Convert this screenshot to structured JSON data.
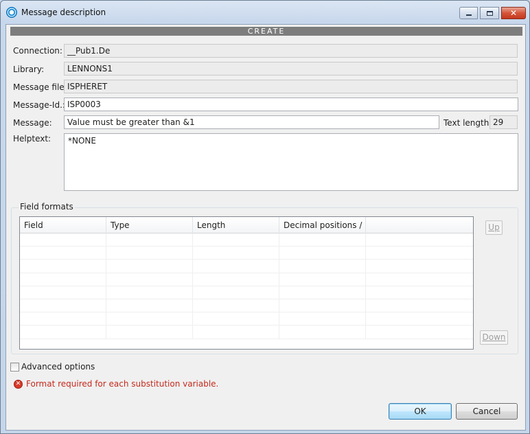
{
  "window": {
    "title": "Message description"
  },
  "banner": "CREATE",
  "form": {
    "connection_label": "Connection:",
    "connection_value": "__Pub1.De",
    "library_label": "Library:",
    "library_value": "LENNONS1",
    "message_file_label": "Message file:",
    "message_file_value": "ISPHERET",
    "message_id_label": "Message-Id.:",
    "message_id_value": "ISP0003",
    "message_label": "Message:",
    "message_value": "Value must be greater than &1",
    "text_length_label": "Text length:",
    "text_length_value": "29",
    "helptext_label": "Helptext:",
    "helptext_value": "*NONE"
  },
  "field_formats": {
    "group_label": "Field formats",
    "columns": [
      "Field",
      "Type",
      "Length",
      "Decimal positions / ...",
      ""
    ],
    "row_count": 8,
    "up_label": "Up",
    "down_label": "Down"
  },
  "advanced_options_label": "Advanced options",
  "advanced_options_checked": false,
  "error_message": "Format required for each substitution variable.",
  "buttons": {
    "ok": "OK",
    "cancel": "Cancel"
  },
  "colors": {
    "banner": "#7d7d7d",
    "error": "#c42a1d",
    "ok_accent": "#3c7fb1"
  }
}
